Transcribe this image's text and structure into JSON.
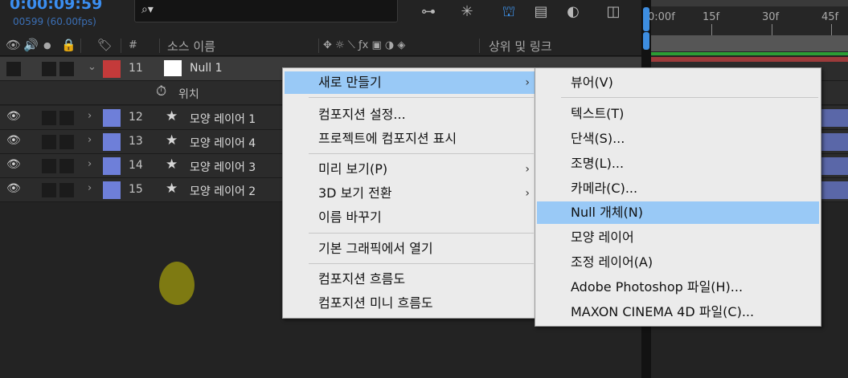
{
  "header": {
    "timecode": "0:00:09:59",
    "frame_info": "00599 (60.00fps)",
    "search_placeholder": "",
    "toolbar_icons": [
      "composition-flowchart-icon",
      "draft-3d-icon",
      "shy-layers-icon",
      "frame-blending-icon",
      "motion-blur-icon",
      "graph-editor-icon"
    ]
  },
  "columns": {
    "av_features_icons": [
      "eye-icon",
      "audio-icon",
      "solo-icon",
      "lock-icon"
    ],
    "label_icon": "tag-icon",
    "number": "#",
    "source_name": "소스 이름",
    "switches_icons": [
      "shy-icon",
      "collapse-icon",
      "quality-icon",
      "fx-icon",
      "frame-blend-icon",
      "motion-blur-icon",
      "adjustment-icon",
      "3d-icon"
    ],
    "parent_link": "상위 및 링크"
  },
  "layers": [
    {
      "num": "11",
      "name": "Null 1",
      "label_color": "#c43a3a",
      "type": "null",
      "expanded": true,
      "selected": true
    },
    {
      "num": "12",
      "name": "모양 레이어 1",
      "label_color": "#6e7fd9",
      "type": "shape",
      "expanded": false
    },
    {
      "num": "13",
      "name": "모양 레이어 4",
      "label_color": "#6e7fd9",
      "type": "shape",
      "expanded": false
    },
    {
      "num": "14",
      "name": "모양 레이어 3",
      "label_color": "#6e7fd9",
      "type": "shape",
      "expanded": false
    },
    {
      "num": "15",
      "name": "모양 레이어 2",
      "label_color": "#6e7fd9",
      "type": "shape",
      "expanded": false
    }
  ],
  "sub_property": {
    "icon": "stopwatch-icon",
    "name": "위치"
  },
  "timeline": {
    "ticks": [
      "0:00f",
      "15f",
      "30f",
      "45f"
    ],
    "work_area_color": "#565656",
    "track_bar_color": "#5a67a8",
    "null_bar_color": "#9c3b3b"
  },
  "context_menu": {
    "items": [
      {
        "label": "새로 만들기",
        "has_submenu": true,
        "highlighted": true
      },
      {
        "label": "컴포지션 설정...",
        "has_submenu": false
      },
      {
        "label": "프로젝트에 컴포지션 표시",
        "has_submenu": false
      },
      {
        "label": "미리 보기(P)",
        "has_submenu": true
      },
      {
        "label": "3D 보기 전환",
        "has_submenu": true
      },
      {
        "label": "이름 바꾸기",
        "has_submenu": false
      },
      {
        "label": "기본 그래픽에서 열기",
        "has_submenu": false
      },
      {
        "label": "컴포지션 흐름도",
        "has_submenu": false
      },
      {
        "label": "컴포지션 미니 흐름도",
        "has_submenu": false
      }
    ],
    "arrow": "›"
  },
  "submenu": {
    "items": [
      {
        "label": "뷰어(V)"
      },
      {
        "label": "텍스트(T)"
      },
      {
        "label": "단색(S)..."
      },
      {
        "label": "조명(L)..."
      },
      {
        "label": "카메라(C)..."
      },
      {
        "label": "Null 개체(N)",
        "highlighted": true
      },
      {
        "label": "모양 레이어"
      },
      {
        "label": "조정 레이어(A)"
      },
      {
        "label": "Adobe Photoshop 파일(H)..."
      },
      {
        "label": "MAXON CINEMA 4D 파일(C)..."
      }
    ]
  },
  "colors": {
    "accent": "#3b8ef0",
    "menu_highlight": "#99c9f6",
    "blob": "#7e7a12"
  }
}
